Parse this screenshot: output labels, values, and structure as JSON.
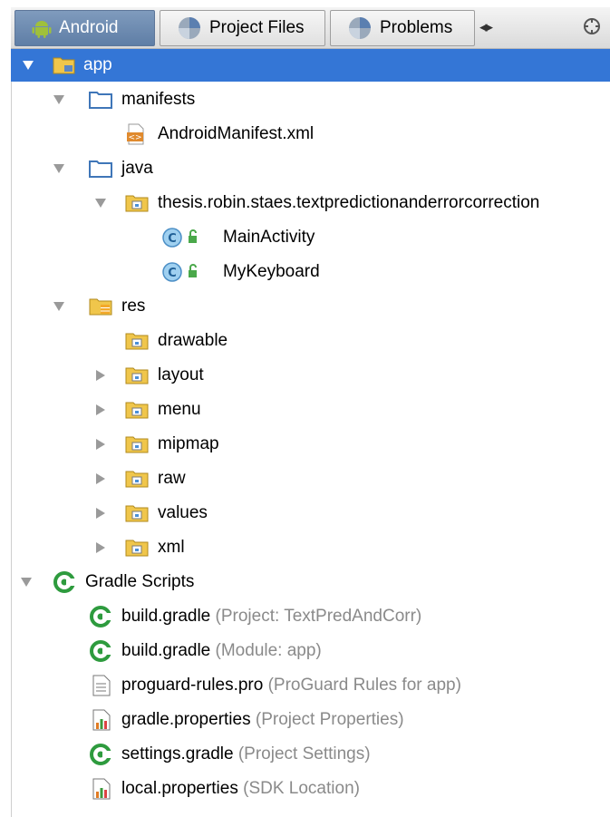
{
  "tabs": [
    {
      "label": "Android",
      "icon": "android-icon",
      "active": true
    },
    {
      "label": "Project Files",
      "icon": "project-files-icon",
      "active": false
    },
    {
      "label": "Problems",
      "icon": "problems-icon",
      "active": false
    }
  ],
  "toolbar": {
    "arrows": "◂▸",
    "settings_icon": "gear-icon"
  },
  "tree": [
    {
      "label": "app",
      "icon": "module-folder-icon",
      "expanded": true,
      "selected": true
    },
    {
      "label": "manifests",
      "icon": "folder-icon",
      "expanded": true
    },
    {
      "label": "AndroidManifest.xml",
      "icon": "xml-file-icon"
    },
    {
      "label": "java",
      "icon": "folder-icon",
      "expanded": true
    },
    {
      "label": "thesis.robin.staes.textpredictionanderrorcorrection",
      "icon": "package-icon",
      "expanded": true
    },
    {
      "label": "MainActivity",
      "icon": "class-icon"
    },
    {
      "label": "MyKeyboard",
      "icon": "class-icon"
    },
    {
      "label": "res",
      "icon": "res-folder-icon",
      "expanded": true
    },
    {
      "label": "drawable",
      "icon": "package-icon"
    },
    {
      "label": "layout",
      "icon": "package-icon",
      "expanded": false
    },
    {
      "label": "menu",
      "icon": "package-icon",
      "expanded": false
    },
    {
      "label": "mipmap",
      "icon": "package-icon",
      "expanded": false
    },
    {
      "label": "raw",
      "icon": "package-icon",
      "expanded": false
    },
    {
      "label": "values",
      "icon": "package-icon",
      "expanded": false
    },
    {
      "label": "xml",
      "icon": "package-icon",
      "expanded": false
    },
    {
      "label": "Gradle Scripts",
      "icon": "gradle-icon",
      "expanded": true
    },
    {
      "label": "build.gradle",
      "hint": "(Project: TextPredAndCorr)",
      "icon": "gradle-icon"
    },
    {
      "label": "build.gradle",
      "hint": "(Module: app)",
      "icon": "gradle-icon"
    },
    {
      "label": "proguard-rules.pro",
      "hint": "(ProGuard Rules for app)",
      "icon": "text-file-icon"
    },
    {
      "label": "gradle.properties",
      "hint": "(Project Properties)",
      "icon": "properties-file-icon"
    },
    {
      "label": "settings.gradle",
      "hint": "(Project Settings)",
      "icon": "gradle-icon"
    },
    {
      "label": "local.properties",
      "hint": "(SDK Location)",
      "icon": "properties-file-icon"
    }
  ],
  "colors": {
    "selection": "#3476d6",
    "active_tab": "#6f8cb2",
    "hint": "#8a8a8a"
  }
}
